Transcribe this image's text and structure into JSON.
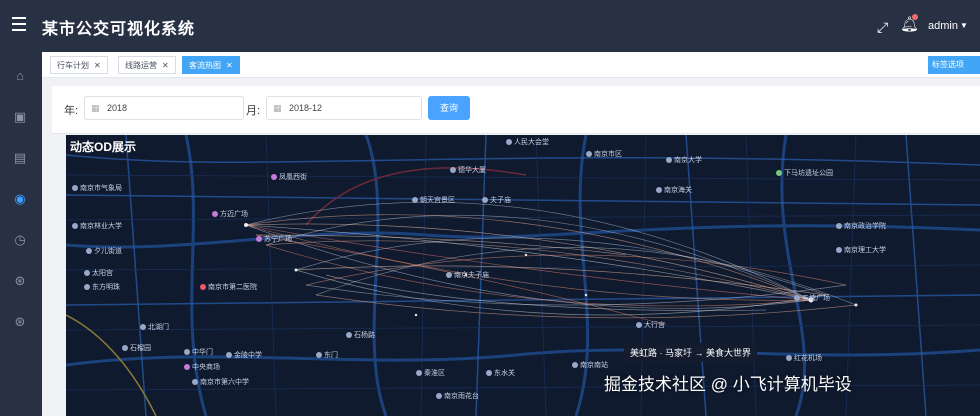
{
  "header": {
    "app_title": "某市公交可视化系统",
    "user_name": "admin",
    "icons": [
      "menu-icon",
      "fullscreen-icon",
      "bell-icon",
      "caret-down-icon"
    ]
  },
  "sidebar": {
    "items": [
      {
        "icon": "home-icon",
        "active": false
      },
      {
        "icon": "image-icon",
        "active": false
      },
      {
        "icon": "document-icon",
        "active": false
      },
      {
        "icon": "globe-icon",
        "active": true
      },
      {
        "icon": "clock-icon",
        "active": false
      },
      {
        "icon": "compass-icon",
        "active": false
      },
      {
        "icon": "compass-alt-icon",
        "active": false
      }
    ]
  },
  "tabs": [
    {
      "label": "行车计划",
      "active": false
    },
    {
      "label": "线路运营",
      "active": false
    },
    {
      "label": "客流热图",
      "active": true
    }
  ],
  "tab_right_button": "标签选项",
  "filter": {
    "year_label": "年:",
    "year_value": "2018",
    "month_label": "月:",
    "month_value": "2018-12",
    "query_label": "查询"
  },
  "map": {
    "title": "动态OD展示",
    "route_tooltip": "美虹路 · 马家圩 → 美食大世界",
    "watermark": "掘金技术社区 @ 小飞计算机毕设",
    "accent_color": "#42a5f5",
    "pois": [
      {
        "label": "人民大会堂",
        "style": "plain"
      },
      {
        "label": "南京市区",
        "style": "plain"
      },
      {
        "label": "南京大学",
        "style": "plain"
      },
      {
        "label": "下马坊遗址公园",
        "style": "green"
      },
      {
        "label": "南京市气象局",
        "style": "plain"
      },
      {
        "label": "凤凰西街",
        "style": "pink"
      },
      {
        "label": "德华大厦",
        "style": "plain"
      },
      {
        "label": "南京海关",
        "style": "plain"
      },
      {
        "label": "朝天宫景区",
        "style": "plain"
      },
      {
        "label": "夫子庙",
        "style": "plain"
      },
      {
        "label": "南京林业大学",
        "style": "plain"
      },
      {
        "label": "南京政治学院",
        "style": "plain"
      },
      {
        "label": "方迈广场",
        "style": "pink"
      },
      {
        "label": "南京理工大学",
        "style": "plain"
      },
      {
        "label": "南京夫子庙",
        "style": "plain"
      },
      {
        "label": "苏宁广场",
        "style": "pink"
      },
      {
        "label": "夕儿街道",
        "style": "plain"
      },
      {
        "label": "太阳宫",
        "style": "plain"
      },
      {
        "label": "东方明珠",
        "style": "plain"
      },
      {
        "label": "南京市第二医院",
        "style": "red"
      },
      {
        "label": "北湖门",
        "style": "plain"
      },
      {
        "label": "石榴园",
        "style": "plain"
      },
      {
        "label": "中华门",
        "style": "plain"
      },
      {
        "label": "金陵中学",
        "style": "plain"
      },
      {
        "label": "东门",
        "style": "plain"
      },
      {
        "label": "中央商场",
        "style": "pink"
      },
      {
        "label": "南京市第六中学",
        "style": "plain"
      },
      {
        "label": "秦淮区",
        "style": "plain"
      },
      {
        "label": "东水关",
        "style": "plain"
      },
      {
        "label": "南京南站",
        "style": "plain"
      },
      {
        "label": "红花机场",
        "style": "plain"
      },
      {
        "label": "石杨路",
        "style": "plain"
      },
      {
        "label": "南京雨花台",
        "style": "plain"
      },
      {
        "label": "五塘广场",
        "style": "plain"
      },
      {
        "label": "大行宫",
        "style": "plain"
      }
    ]
  }
}
